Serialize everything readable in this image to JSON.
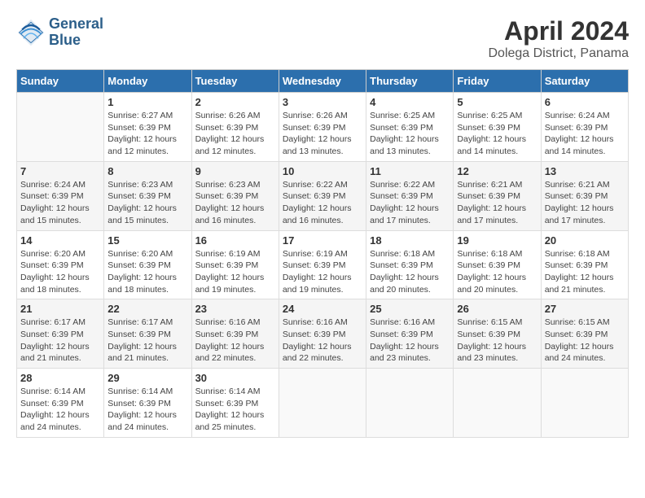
{
  "header": {
    "logo_line1": "General",
    "logo_line2": "Blue",
    "title": "April 2024",
    "subtitle": "Dolega District, Panama"
  },
  "weekdays": [
    "Sunday",
    "Monday",
    "Tuesday",
    "Wednesday",
    "Thursday",
    "Friday",
    "Saturday"
  ],
  "weeks": [
    [
      {
        "day": "",
        "info": ""
      },
      {
        "day": "1",
        "info": "Sunrise: 6:27 AM\nSunset: 6:39 PM\nDaylight: 12 hours\nand 12 minutes."
      },
      {
        "day": "2",
        "info": "Sunrise: 6:26 AM\nSunset: 6:39 PM\nDaylight: 12 hours\nand 12 minutes."
      },
      {
        "day": "3",
        "info": "Sunrise: 6:26 AM\nSunset: 6:39 PM\nDaylight: 12 hours\nand 13 minutes."
      },
      {
        "day": "4",
        "info": "Sunrise: 6:25 AM\nSunset: 6:39 PM\nDaylight: 12 hours\nand 13 minutes."
      },
      {
        "day": "5",
        "info": "Sunrise: 6:25 AM\nSunset: 6:39 PM\nDaylight: 12 hours\nand 14 minutes."
      },
      {
        "day": "6",
        "info": "Sunrise: 6:24 AM\nSunset: 6:39 PM\nDaylight: 12 hours\nand 14 minutes."
      }
    ],
    [
      {
        "day": "7",
        "info": "Sunrise: 6:24 AM\nSunset: 6:39 PM\nDaylight: 12 hours\nand 15 minutes."
      },
      {
        "day": "8",
        "info": "Sunrise: 6:23 AM\nSunset: 6:39 PM\nDaylight: 12 hours\nand 15 minutes."
      },
      {
        "day": "9",
        "info": "Sunrise: 6:23 AM\nSunset: 6:39 PM\nDaylight: 12 hours\nand 16 minutes."
      },
      {
        "day": "10",
        "info": "Sunrise: 6:22 AM\nSunset: 6:39 PM\nDaylight: 12 hours\nand 16 minutes."
      },
      {
        "day": "11",
        "info": "Sunrise: 6:22 AM\nSunset: 6:39 PM\nDaylight: 12 hours\nand 17 minutes."
      },
      {
        "day": "12",
        "info": "Sunrise: 6:21 AM\nSunset: 6:39 PM\nDaylight: 12 hours\nand 17 minutes."
      },
      {
        "day": "13",
        "info": "Sunrise: 6:21 AM\nSunset: 6:39 PM\nDaylight: 12 hours\nand 17 minutes."
      }
    ],
    [
      {
        "day": "14",
        "info": "Sunrise: 6:20 AM\nSunset: 6:39 PM\nDaylight: 12 hours\nand 18 minutes."
      },
      {
        "day": "15",
        "info": "Sunrise: 6:20 AM\nSunset: 6:39 PM\nDaylight: 12 hours\nand 18 minutes."
      },
      {
        "day": "16",
        "info": "Sunrise: 6:19 AM\nSunset: 6:39 PM\nDaylight: 12 hours\nand 19 minutes."
      },
      {
        "day": "17",
        "info": "Sunrise: 6:19 AM\nSunset: 6:39 PM\nDaylight: 12 hours\nand 19 minutes."
      },
      {
        "day": "18",
        "info": "Sunrise: 6:18 AM\nSunset: 6:39 PM\nDaylight: 12 hours\nand 20 minutes."
      },
      {
        "day": "19",
        "info": "Sunrise: 6:18 AM\nSunset: 6:39 PM\nDaylight: 12 hours\nand 20 minutes."
      },
      {
        "day": "20",
        "info": "Sunrise: 6:18 AM\nSunset: 6:39 PM\nDaylight: 12 hours\nand 21 minutes."
      }
    ],
    [
      {
        "day": "21",
        "info": "Sunrise: 6:17 AM\nSunset: 6:39 PM\nDaylight: 12 hours\nand 21 minutes."
      },
      {
        "day": "22",
        "info": "Sunrise: 6:17 AM\nSunset: 6:39 PM\nDaylight: 12 hours\nand 21 minutes."
      },
      {
        "day": "23",
        "info": "Sunrise: 6:16 AM\nSunset: 6:39 PM\nDaylight: 12 hours\nand 22 minutes."
      },
      {
        "day": "24",
        "info": "Sunrise: 6:16 AM\nSunset: 6:39 PM\nDaylight: 12 hours\nand 22 minutes."
      },
      {
        "day": "25",
        "info": "Sunrise: 6:16 AM\nSunset: 6:39 PM\nDaylight: 12 hours\nand 23 minutes."
      },
      {
        "day": "26",
        "info": "Sunrise: 6:15 AM\nSunset: 6:39 PM\nDaylight: 12 hours\nand 23 minutes."
      },
      {
        "day": "27",
        "info": "Sunrise: 6:15 AM\nSunset: 6:39 PM\nDaylight: 12 hours\nand 24 minutes."
      }
    ],
    [
      {
        "day": "28",
        "info": "Sunrise: 6:14 AM\nSunset: 6:39 PM\nDaylight: 12 hours\nand 24 minutes."
      },
      {
        "day": "29",
        "info": "Sunrise: 6:14 AM\nSunset: 6:39 PM\nDaylight: 12 hours\nand 24 minutes."
      },
      {
        "day": "30",
        "info": "Sunrise: 6:14 AM\nSunset: 6:39 PM\nDaylight: 12 hours\nand 25 minutes."
      },
      {
        "day": "",
        "info": ""
      },
      {
        "day": "",
        "info": ""
      },
      {
        "day": "",
        "info": ""
      },
      {
        "day": "",
        "info": ""
      }
    ]
  ]
}
